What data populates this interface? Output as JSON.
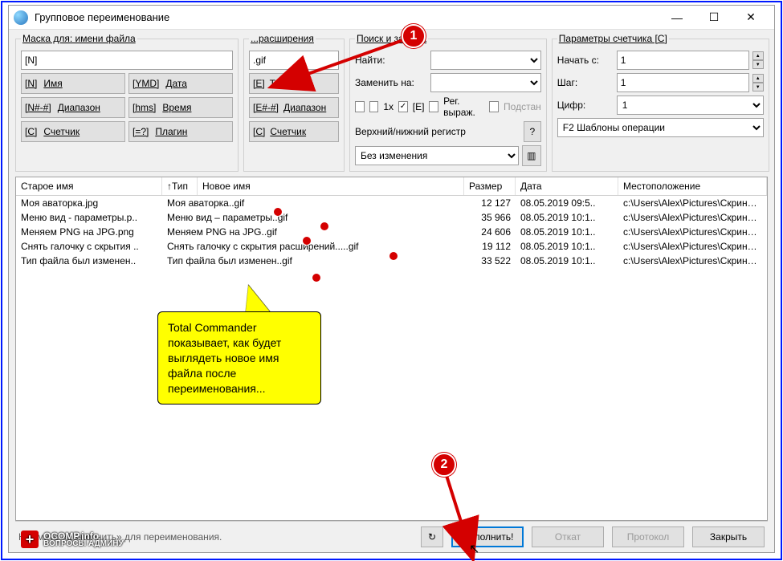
{
  "window": {
    "title": "Групповое переименование",
    "minimize": "—",
    "maximize": "☐",
    "close": "✕"
  },
  "mask": {
    "legend": "Маска для: имени файла",
    "value": "[N]",
    "btn_name_code": "[N]",
    "btn_name": "Имя",
    "btn_ymd_code": "[YMD]",
    "btn_ymd": "Дата",
    "btn_range_code": "[N#-#]",
    "btn_range": "Диапазон",
    "btn_hms_code": "[hms]",
    "btn_hms": "Время",
    "btn_counter_code": "[C]",
    "btn_counter": "Счетчик",
    "btn_plugin_code": "[=?]",
    "btn_plugin": "Плагин"
  },
  "ext": {
    "legend": "...расширения",
    "value": ".gif",
    "btn_e_code": "[E]",
    "btn_e": "Тип",
    "btn_erange_code": "[E#-#]",
    "btn_erange": "Диапазон",
    "btn_counter_code": "[C]",
    "btn_counter": "Счетчик"
  },
  "search": {
    "legend": "Поиск и замена",
    "find_label": "Найти:",
    "replace_label": "Заменить на:",
    "find_value": "",
    "replace_value": "",
    "chk_1x": "1x",
    "chk_e": "[E]",
    "chk_e_checked": "✓",
    "chk_regex": "Рег. выраж.",
    "chk_subst": "Подстан",
    "case_label": "Верхний/нижний регистр",
    "case_value": "Без изменения",
    "help": "?"
  },
  "counter": {
    "legend": "Параметры счетчика [C]",
    "start_label": "Начать с:",
    "start_value": "1",
    "step_label": "Шаг:",
    "step_value": "1",
    "digits_label": "Цифр:",
    "digits_value": "1"
  },
  "templates": {
    "label": "F2 Шаблоны операции"
  },
  "table": {
    "headers": {
      "old": "Старое имя",
      "type": "↑Тип",
      "new": "Новое имя",
      "size": "Размер",
      "date": "Дата",
      "loc": "Местоположение"
    },
    "rows": [
      {
        "old": "Моя аваторка.jpg",
        "new": "Моя аваторка..gif",
        "size": "12 127",
        "date": "08.05.2019 09:5..",
        "loc": "c:\\Users\\Alex\\Pictures\\Скриншоты\\"
      },
      {
        "old": "Меню вид - параметры.p..",
        "new": "Меню вид – параметры..gif",
        "size": "35 966",
        "date": "08.05.2019 10:1..",
        "loc": "c:\\Users\\Alex\\Pictures\\Скриншоты\\"
      },
      {
        "old": "Меняем PNG на JPG.png",
        "new": "Меняем PNG на JPG..gif",
        "size": "24 606",
        "date": "08.05.2019 10:1..",
        "loc": "c:\\Users\\Alex\\Pictures\\Скриншоты\\"
      },
      {
        "old": "Снять галочку с скрытия ..",
        "new": "Снять галочку с скрытия расширений.....gif",
        "size": "19 112",
        "date": "08.05.2019 10:1..",
        "loc": "c:\\Users\\Alex\\Pictures\\Скриншоты\\"
      },
      {
        "old": "Тип файла был изменен..",
        "new": "Тип файла был изменен..gif",
        "size": "33 522",
        "date": "08.05.2019 10:1..",
        "loc": "c:\\Users\\Alex\\Pictures\\Скриншоты\\"
      }
    ]
  },
  "footer": {
    "hint": "Нажмите «Выполнить» для переименования.",
    "reload": "↻",
    "execute": "Выполнить!",
    "undo": "Откат",
    "protocol": "Протокол",
    "close": "Закрыть"
  },
  "annotations": {
    "badge1": "1",
    "badge2": "2",
    "callout": "Total Commander показывает, как будет выглядеть новое имя файла после переименования..."
  },
  "watermark": {
    "main": "OCOMP.info",
    "sub": "ВОПРОСЫ АДМИНУ"
  }
}
